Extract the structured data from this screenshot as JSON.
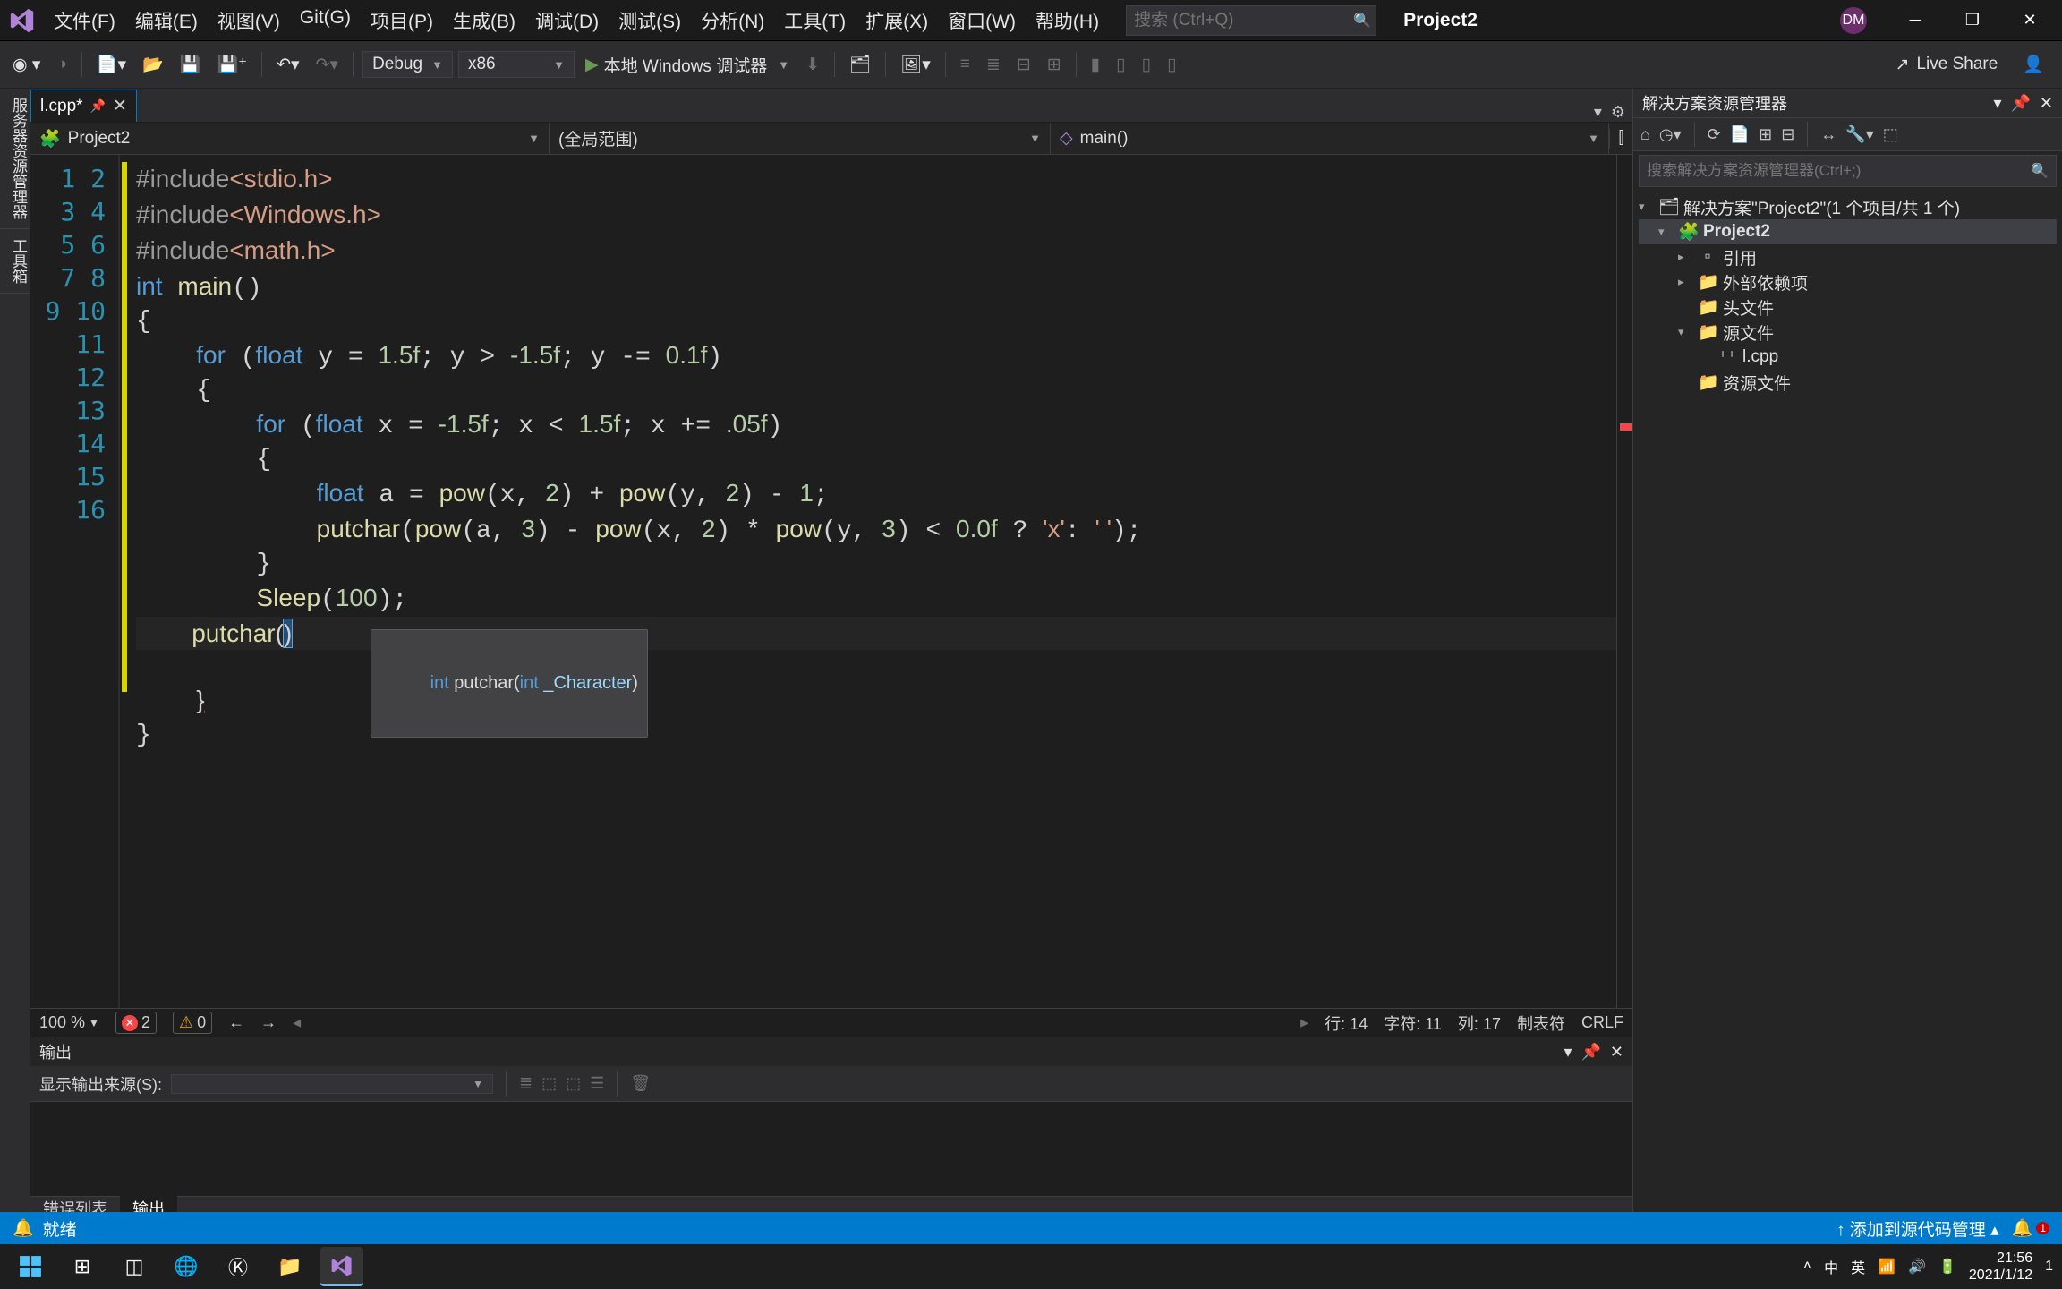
{
  "title": {
    "project": "Project2",
    "search_placeholder": "搜索 (Ctrl+Q)",
    "avatar": "DM"
  },
  "menu": [
    "文件(F)",
    "编辑(E)",
    "视图(V)",
    "Git(G)",
    "项目(P)",
    "生成(B)",
    "调试(D)",
    "测试(S)",
    "分析(N)",
    "工具(T)",
    "扩展(X)",
    "窗口(W)",
    "帮助(H)"
  ],
  "toolbar": {
    "config": "Debug",
    "platform": "x86",
    "run_label": "本地 Windows 调试器",
    "live_share": "Live Share"
  },
  "tab": {
    "filename": "l.cpp*"
  },
  "left_strips": [
    "服务器资源管理器",
    "工具箱"
  ],
  "scope": {
    "project": "Project2",
    "global": "(全局范围)",
    "func": "main()"
  },
  "code": {
    "lines": [
      "#include<stdio.h>",
      "#include<Windows.h>",
      "#include<math.h>",
      "int main()",
      "{",
      "    for (float y = 1.5f; y > -1.5f; y -= 0.1f)",
      "    {",
      "        for (float x = -1.5f; x < 1.5f; x += .05f)",
      "        {",
      "            float a = pow(x, 2) + pow(y, 2) - 1;",
      "            putchar(pow(a, 3) - pow(x, 2) * pow(y, 3) < 0.0f ? 'x': ' ');",
      "        }",
      "        Sleep(100);",
      "        putchar()",
      "    }",
      "}"
    ],
    "tooltip_int": "int",
    "tooltip_func": "putchar",
    "tooltip_param_type": "int",
    "tooltip_param_name": "_Character"
  },
  "editor_status": {
    "zoom": "100 %",
    "errors": "2",
    "warnings": "0",
    "line_label": "行:",
    "line": "14",
    "char_label": "字符:",
    "char": "11",
    "col_label": "列:",
    "col": "17",
    "tabs_label": "制表符",
    "eol": "CRLF"
  },
  "output": {
    "title": "输出",
    "source_label": "显示输出来源(S):",
    "tabs": [
      "错误列表",
      "输出"
    ]
  },
  "solution": {
    "title": "解决方案资源管理器",
    "search_placeholder": "搜索解决方案资源管理器(Ctrl+;)",
    "root": "解决方案\"Project2\"(1 个项目/共 1 个)",
    "project": "Project2",
    "nodes": [
      "引用",
      "外部依赖项",
      "头文件",
      "源文件",
      "l.cpp",
      "资源文件"
    ]
  },
  "status": {
    "ready": "就绪",
    "add_source": "添加到源代码管理",
    "notif_count": "1"
  },
  "taskbar": {
    "ime1": "中",
    "ime2": "英",
    "time": "21:56",
    "date": "2021/1/12",
    "extra": "1"
  }
}
